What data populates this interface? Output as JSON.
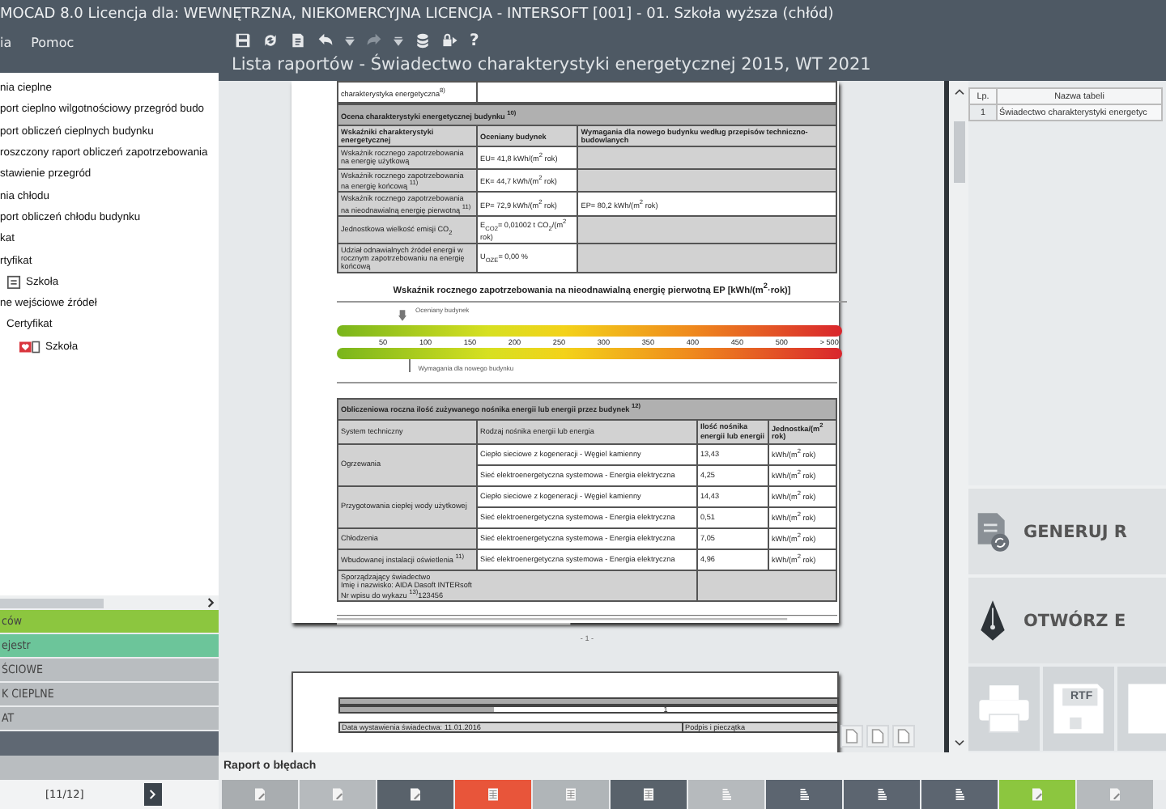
{
  "window": {
    "title": "MOCAD 8.0 Licencja dla: WEWNĘTRZNA, NIEKOMERCYJNA LICENCJA - INTERSOFT [001] - 01. Szkoła wyższa (chłód)"
  },
  "menu": [
    "ia",
    "Pomoc"
  ],
  "toolbar": [
    {
      "kind": "save"
    },
    {
      "kind": "refresh"
    },
    {
      "kind": "export"
    },
    {
      "kind": "undo"
    },
    {
      "kind": "caret"
    },
    {
      "kind": "redo"
    },
    {
      "kind": "caret"
    },
    {
      "kind": "stack"
    },
    {
      "kind": "lock"
    },
    {
      "kind": "text",
      "label": "?"
    }
  ],
  "report_title": "Lista raportów - Świadectwo charakterystyki energetycznej 2015, WT 2021",
  "tree": [
    {
      "label": "nia cieplne"
    },
    {
      "label": "port cieplno wilgotnościowy przegród budo"
    },
    {
      "label": "port obliczeń cieplnych budynku"
    },
    {
      "label": "roszczony raport obliczeń zapotrzebowania"
    },
    {
      "label": "stawienie przegród"
    },
    {
      "label": "nia chłodu"
    },
    {
      "label": "port obliczeń chłodu budynku"
    },
    {
      "label": "kat"
    },
    {
      "label": "rtyfikat",
      "children": [
        {
          "label": "Szkoła",
          "kind": "document"
        }
      ]
    },
    {
      "label": "ne wejściowe źródeł",
      "children": [
        {
          "label": "Certyfikat",
          "children": [
            {
              "label": "Szkoła",
              "kind": "heart-document"
            }
          ]
        }
      ]
    }
  ],
  "nav": [
    {
      "label": "ców",
      "color": "#8cc63f"
    },
    {
      "label": "ejestr",
      "color": "#6cc59a"
    },
    {
      "label": "ŚCIOWE",
      "color": "#b9bdc0"
    },
    {
      "label": "K CIEPLNE",
      "color": "#b9bdc0"
    },
    {
      "label": "AT",
      "color": "#b9bdc0"
    }
  ],
  "pager": {
    "text": "[11/12]"
  },
  "document": {
    "top_row": "charakterystyka energetyczna$^{8)}$",
    "assessment": {
      "title": "Ocena charakterystyki energetycznej budynku $^{10)}$",
      "columns": [
        "Wskaźniki charakterystyki energetycznej",
        "Oceniany budynek",
        "Wymagania dla nowego budynku według przepisów techniczno-budowlanych"
      ],
      "rows": [
        [
          "Wskaźnik rocznego zapotrzebowania na energię użytkową",
          "EU= 41,8 kWh/(m$^{2}$ rok)",
          ""
        ],
        [
          "Wskaźnik rocznego zapotrzebowania na energię końcową $^{11)}$",
          "EK= 44,7 kWh/(m$^{2}$ rok)",
          ""
        ],
        [
          "Wskaźnik rocznego zapotrzebowania na nieodnawialną energię pierwotną $^{11)}$",
          "EP= 72,9 kWh/(m$^{2}$ rok)",
          "EP= 80,2 kWh/(m$^{2}$ rok)"
        ],
        [
          "Jednostkowa wielkość emisji CO$_{2}$",
          "E$_{CO2}$= 0,01002 t CO$_{2}$/(m$^{2}$ rok)",
          ""
        ],
        [
          "Udział odnawialnych źródeł energii w rocznym zapotrzebowaniu na energię końcową",
          "U$_{OZE}$= 0,00 %",
          ""
        ]
      ]
    },
    "scale": {
      "title": "Wskaźnik rocznego zapotrzebowania na nieodnawialną energię pierwotną EP [kWh/(m$^{2}$·rok)]",
      "ticks": [
        "50",
        "100",
        "150",
        "200",
        "250",
        "300",
        "350",
        "400",
        "450",
        "500",
        "> 500"
      ],
      "markers": [
        {
          "kind": "above",
          "label": "Oceniany budynek",
          "level": 0.13
        },
        {
          "kind": "below",
          "label": "Wymagania dla nowego budynku",
          "level": 0.145
        }
      ]
    },
    "usage": {
      "title": "Obliczeniowa roczna ilość zużywanego nośnika energii lub energii przez budynek $^{12)}$",
      "columns": [
        "System techniczny",
        "Rodzaj nośnika energii lub energia",
        "Ilość nośnika energii lub energii",
        "Jednostka/(m$^{2}$ rok)"
      ],
      "systems": [
        {
          "name": "Ogrzewania",
          "rows": [
            [
              "Ciepło sieciowe z kogeneracji - Węgiel kamienny",
              "13,43",
              "kWh/(m$^{2}$ rok)"
            ],
            [
              "Sieć elektroenergetyczna systemowa - Energia elektryczna",
              "4,25",
              "kWh/(m$^{2}$ rok)"
            ]
          ]
        },
        {
          "name": "Przygotowania ciepłej wody użytkowej",
          "rows": [
            [
              "Ciepło sieciowe z kogeneracji - Węgiel kamienny",
              "14,43",
              "kWh/(m$^{2}$ rok)"
            ],
            [
              "Sieć elektroenergetyczna systemowa - Energia elektryczna",
              "0,51",
              "kWh/(m$^{2}$ rok)"
            ]
          ]
        },
        {
          "name": "Chłodzenia",
          "rows": [
            [
              "Sieć elektroenergetyczna systemowa - Energia elektryczna",
              "7,05",
              "kWh/(m$^{2}$ rok)"
            ]
          ]
        },
        {
          "name": "Wbudowanej instalacji oświetlenia $^{11)}$",
          "rows": [
            [
              "Sieć elektroenergetyczna systemowa - Energia elektryczna",
              "4,96",
              "kWh/(m$^{2}$ rok)"
            ]
          ]
        }
      ],
      "signer": [
        "Sporządzający świadectwo",
        "Imię i nazwisko: AIDA Dasoft INTERsoft",
        "Nr wpisu do wykazu $^{13)}$123456"
      ]
    },
    "page_number": "- 1 -",
    "page2": {
      "value": "1",
      "date": "Data wystawienia świadectwa: 11.01.2016",
      "signature": "Podpis i pieczątka"
    }
  },
  "report_list": {
    "columns": [
      "Lp.",
      "Nazwa tabeli"
    ],
    "rows": [
      {
        "no": "1",
        "name": "Świadectwo charakterystyki energetyc",
        "selected": false
      }
    ]
  },
  "actions": [
    {
      "kind": "generate",
      "label": "GENERUJ R"
    },
    {
      "kind": "open",
      "label": "OTWÓRZ E"
    }
  ],
  "export": [
    {
      "kind": "print"
    },
    {
      "kind": "rtf",
      "label": "RTF"
    },
    {
      "kind": "doc"
    }
  ],
  "error_report": "Raport o błędach",
  "bottom_bar": [
    {
      "kind": "doc-edit",
      "color": "#a9adb0"
    },
    {
      "kind": "doc-edit",
      "color": "#b6babd"
    },
    {
      "kind": "doc-edit",
      "color": "#59626b"
    },
    {
      "kind": "table",
      "color": "#e8553a"
    },
    {
      "kind": "table",
      "color": "#b0b5b8"
    },
    {
      "kind": "table",
      "color": "#59626b"
    },
    {
      "kind": "list",
      "color": "#b6babd"
    },
    {
      "kind": "list",
      "color": "#5c6570"
    },
    {
      "kind": "list",
      "color": "#5c6570"
    },
    {
      "kind": "list",
      "color": "#5c6570"
    },
    {
      "kind": "doc-edit",
      "color": "#8cc63f"
    },
    {
      "kind": "doc-edit",
      "color": "#b6babd"
    }
  ]
}
